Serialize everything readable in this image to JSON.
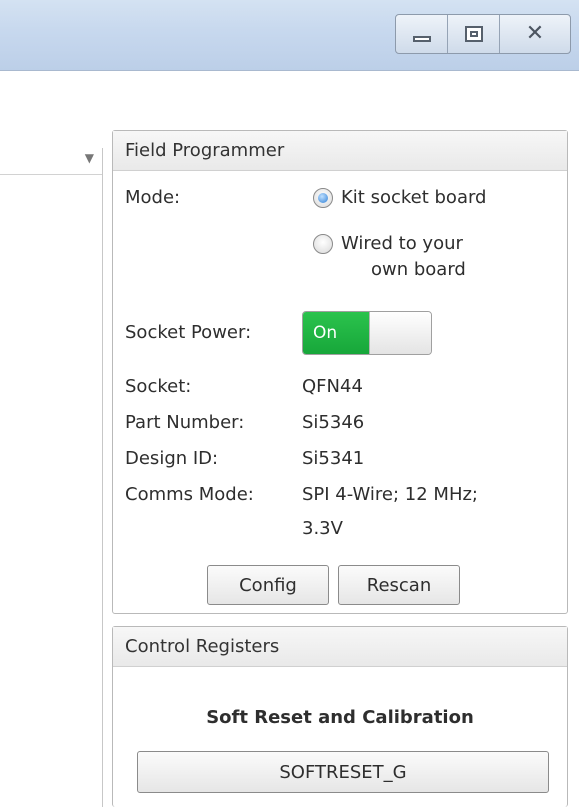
{
  "window": {
    "minimize_icon": "minimize-icon",
    "maximize_icon": "maximize-icon",
    "close_icon": "close-icon"
  },
  "left_pane": {
    "dropdown_icon": "chevron-down-icon"
  },
  "field_programmer": {
    "title": "Field Programmer",
    "mode_label": "Mode:",
    "mode_options": [
      {
        "label": "Kit socket board",
        "selected": true
      },
      {
        "label_line1": "Wired to your",
        "label_line2": "own board",
        "selected": false
      }
    ],
    "socket_power_label": "Socket Power:",
    "socket_power_state": "On",
    "socket_label": "Socket:",
    "socket_value": "QFN44",
    "part_number_label": "Part Number:",
    "part_number_value": "Si5346",
    "design_id_label": "Design ID:",
    "design_id_value": "Si5341",
    "comms_mode_label": "Comms Mode:",
    "comms_mode_value_line1": "SPI 4-Wire; 12 MHz;",
    "comms_mode_value_line2": "3.3V",
    "config_button": "Config",
    "rescan_button": "Rescan"
  },
  "control_registers": {
    "title": "Control Registers",
    "section_title": "Soft Reset and Calibration",
    "softreset_button": "SOFTRESET_G"
  },
  "colors": {
    "toggle_on": "#1fb543",
    "radio_selected": "#2e7fd6",
    "titlebar": "#c7d8ee"
  }
}
